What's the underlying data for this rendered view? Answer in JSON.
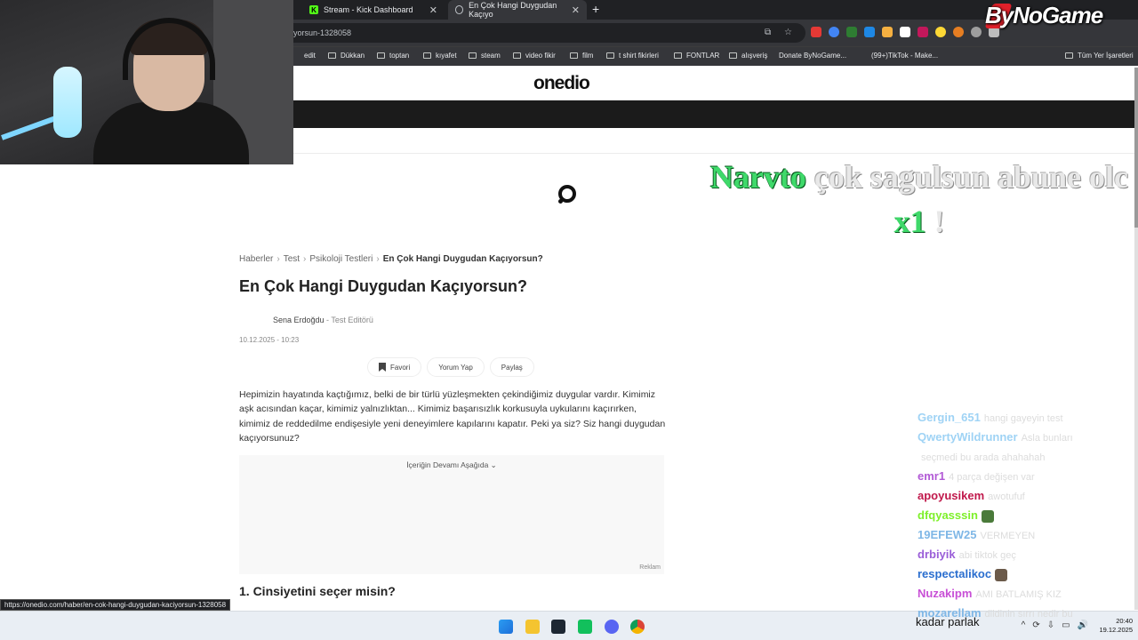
{
  "browser": {
    "tabs": [
      {
        "label": "Stream - Kick Dashboard"
      },
      {
        "label": "En Çok Hangi Duygudan Kaçıyo"
      }
    ],
    "new_tab": "+",
    "close": "✕",
    "url": "yorsun-1328058",
    "bookmarks": [
      "edit",
      "Dükkan",
      "toptan",
      "kıyafet",
      "steam",
      "video fikir",
      "film",
      "t shirt fikirleri",
      "FONTLAR",
      "alışveriş",
      "Donate ByNoGame...",
      "(99+)TikTok - Make...",
      "Tüm Yer İşaretleri"
    ],
    "status_url": "https://onedio.com/haber/en-cok-hangi-duygudan-kaciyorsun-1328058"
  },
  "site": {
    "logo": "onedio",
    "breadcrumb": [
      "Haberler",
      "Test",
      "Psikoloji Testleri",
      "En Çok Hangi Duygudan Kaçıyorsun?"
    ],
    "breadcrumb_sep": "›",
    "title": "En Çok Hangi Duygudan Kaçıyorsun?",
    "author": "Sena Erdoğdu",
    "author_role": " - Test Editörü",
    "date": "10.12.2025 - 10:23",
    "actions": {
      "favori": "Favori",
      "yorum": "Yorum Yap",
      "paylas": "Paylaş"
    },
    "intro": "Hepimizin hayatında kaçtığımız, belki de bir türlü yüzleşmekten çekindiğimiz duygular vardır. Kimimiz aşk acısından kaçar, kimimiz yalnızlıktan... Kimimiz başarısızlık korkusuyla uykularını kaçırırken, kimimiz de reddedilme endişesiyle yeni deneyimlere kapılarını kapatır. Peki ya siz? Siz hangi duygudan kaçıyorsunuz?",
    "ad_continue": "İçeriğin Devamı Aşağıda ⌄",
    "ad_label": "Reklam",
    "question1": "1. Cinsiyetini seçer misin?"
  },
  "overlay": {
    "brand": "ByNoGame",
    "alert_name": "Narvto",
    "alert_message": "çok sagulsun abune olc",
    "alert_multiplier": "x1",
    "alert_excl": "!",
    "chat": [
      {
        "user": "Gergin_651",
        "msg": "hangi gayeyin test",
        "color": "#9fd3f5"
      },
      {
        "user": "QwertyWildrunner",
        "msg": "Asla bunları",
        "color": "#9fd3f5"
      },
      {
        "user": "",
        "msg": "seçmedi bu arada ahahahah",
        "color": "#9fd3f5"
      },
      {
        "user": "emr1",
        "msg": "4 parça değişen var",
        "color": "#b25ad6"
      },
      {
        "user": "apoyusikem",
        "msg": "awotufuf",
        "color": "#c0184b"
      },
      {
        "user": "dfqyasssin",
        "msg": "",
        "color": "#7ef02a"
      },
      {
        "user": "19EFEW25",
        "msg": "VERMEYEN",
        "color": "#7fb7e6"
      },
      {
        "user": "drbiyik",
        "msg": "abi tiktok geç",
        "color": "#9a5ed8"
      },
      {
        "user": "respectalikoc",
        "msg": "",
        "color": "#2a6ecf"
      },
      {
        "user": "Nuzakipm",
        "msg": "AMI BATLAMIŞ KIZ",
        "color": "#c84fd6"
      },
      {
        "user": "mozarellam",
        "msg": "dildinin sırrı nedir bu",
        "color": "#7fb7e6"
      }
    ]
  },
  "taskbar": {
    "notification": "kadar parlak",
    "time": "20:40",
    "date": "19.12.2025",
    "tray": [
      "^",
      "⟳",
      "⇩",
      "▭",
      "🔊"
    ]
  },
  "colors": {
    "chrome_dark": "#202124",
    "chrome_mid": "#35363a",
    "alert_green": "#3fd96a",
    "brand_red": "#e0202a"
  }
}
